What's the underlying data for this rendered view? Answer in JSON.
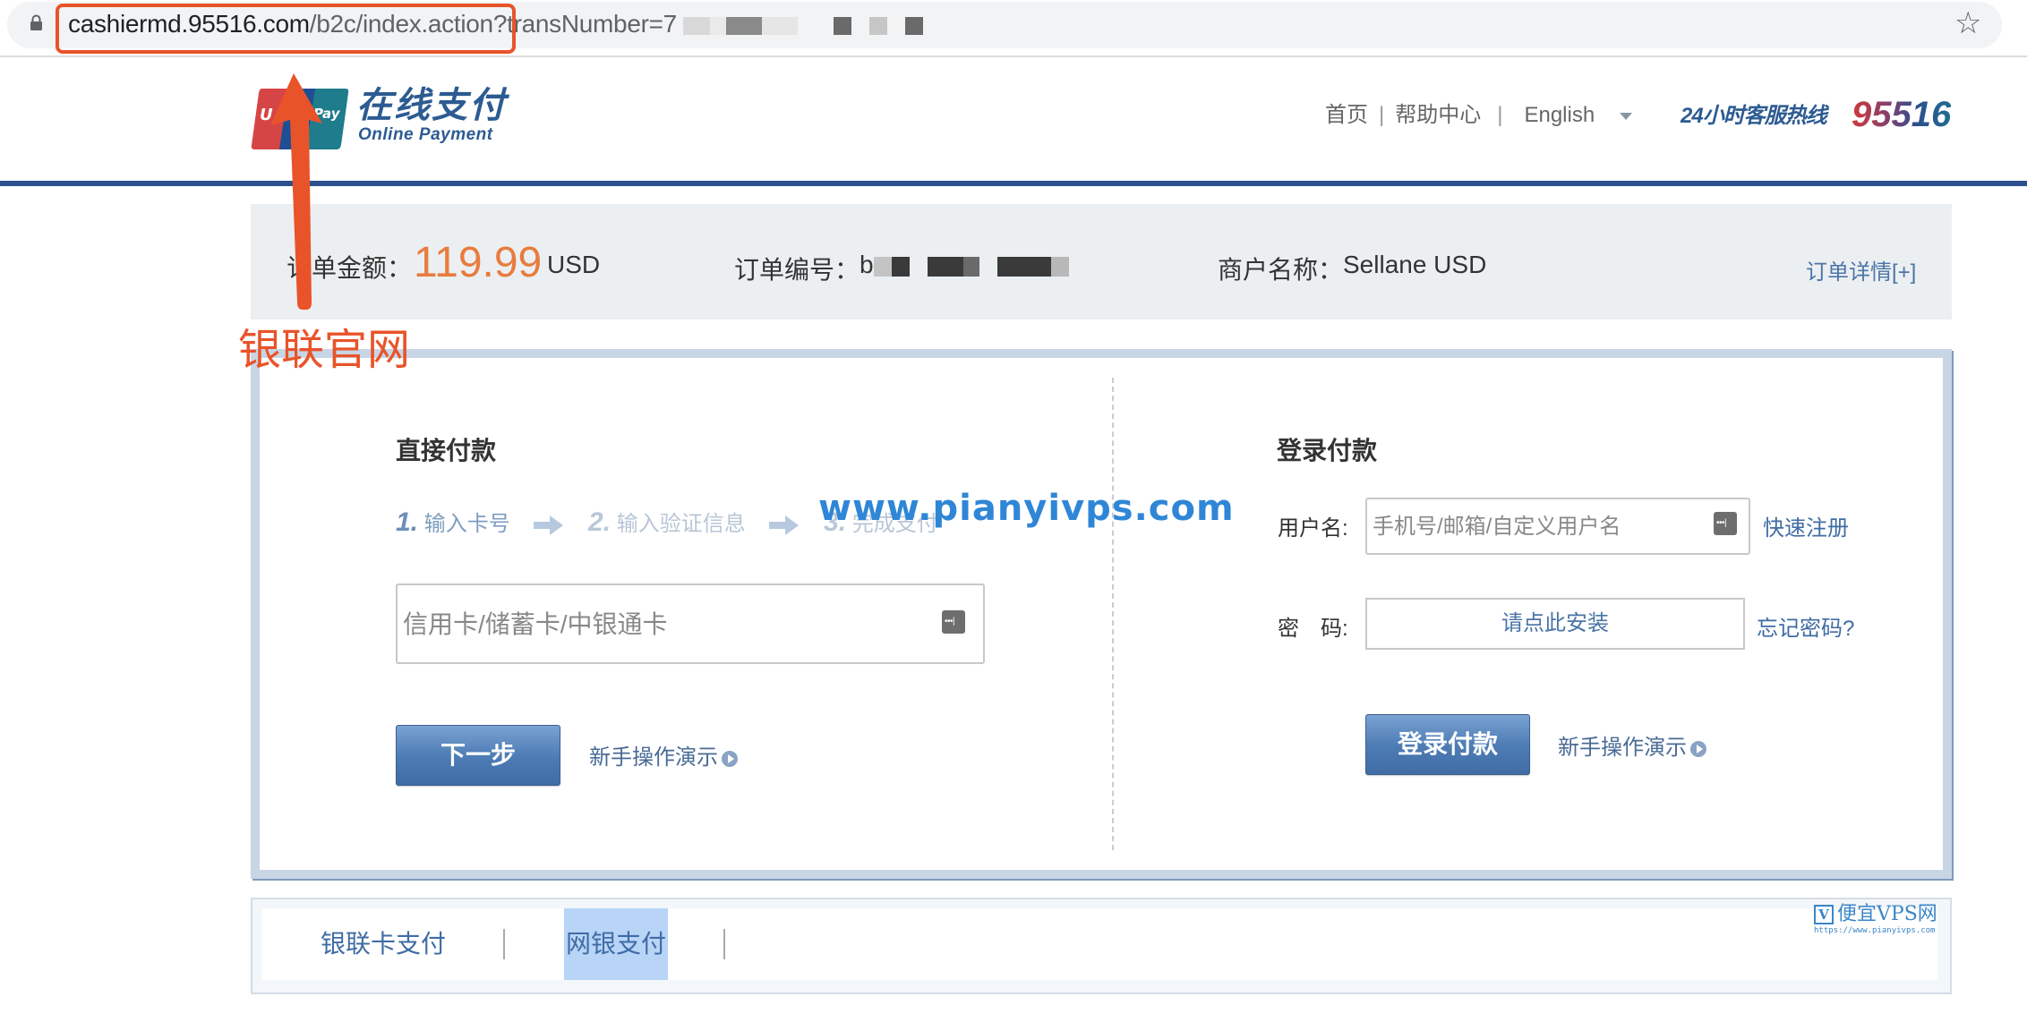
{
  "browser": {
    "url_host": "cashiermd.95516.com",
    "url_path": "/b2c/index.actio",
    "url_rest": "n?transNumber=7",
    "url_redacted": true,
    "lock_icon": "lock-icon",
    "star_icon": "star-icon",
    "star_glyph": "☆"
  },
  "header": {
    "logo_cn": "在线支付",
    "logo_en": "Online  Payment",
    "nav": {
      "home": "首页",
      "sep": "|",
      "help": "帮助中心",
      "language": "English"
    },
    "hotline_label": "24小时客服热线",
    "hotline_number": "95516"
  },
  "order": {
    "amount_label": "订单金额：",
    "amount": "119.99",
    "currency": "USD",
    "order_no_label": "订单编号：",
    "order_no_prefix": "b",
    "merchant_label": "商户名称：",
    "merchant": "Sellane USD",
    "details_link": "订单详情[+]"
  },
  "annotation": {
    "label": "银联官网",
    "color": "#e9532a"
  },
  "direct_pay": {
    "heading": "直接付款",
    "steps": [
      {
        "num": "1.",
        "label": "输入卡号",
        "active": true
      },
      {
        "num": "2.",
        "label": "输入验证信息",
        "active": false
      },
      {
        "num": "3.",
        "label": "完成支付",
        "active": false
      }
    ],
    "card_placeholder": "信用卡/储蓄卡/中银通卡",
    "next_button": "下一步",
    "demo_link": "新手操作演示"
  },
  "watermark": {
    "text": "www.pianyivps.com",
    "badge_v": "V",
    "badge_name": "便宜VPS网",
    "badge_url": "https://www.pianyivps.com"
  },
  "login_pay": {
    "heading": "登录付款",
    "username_label": "用户名:",
    "username_placeholder": "手机号/邮箱/自定义用户名",
    "register_link": "快速注册",
    "password_label": "密　码:",
    "password_install": "请点此安装",
    "forgot_link": "忘记密码?",
    "login_button": "登录付款",
    "demo_link": "新手操作演示"
  },
  "bottom_tabs": [
    {
      "label": "银联卡支付",
      "selected": false
    },
    {
      "label": "网银支付",
      "selected": true
    }
  ],
  "colors": {
    "brand_blue": "#2d4f8f",
    "amount_orange": "#e87c3e",
    "link_blue": "#3f6ca4",
    "button_blue": "#4f7db5",
    "annotation_red": "#e9532a"
  }
}
